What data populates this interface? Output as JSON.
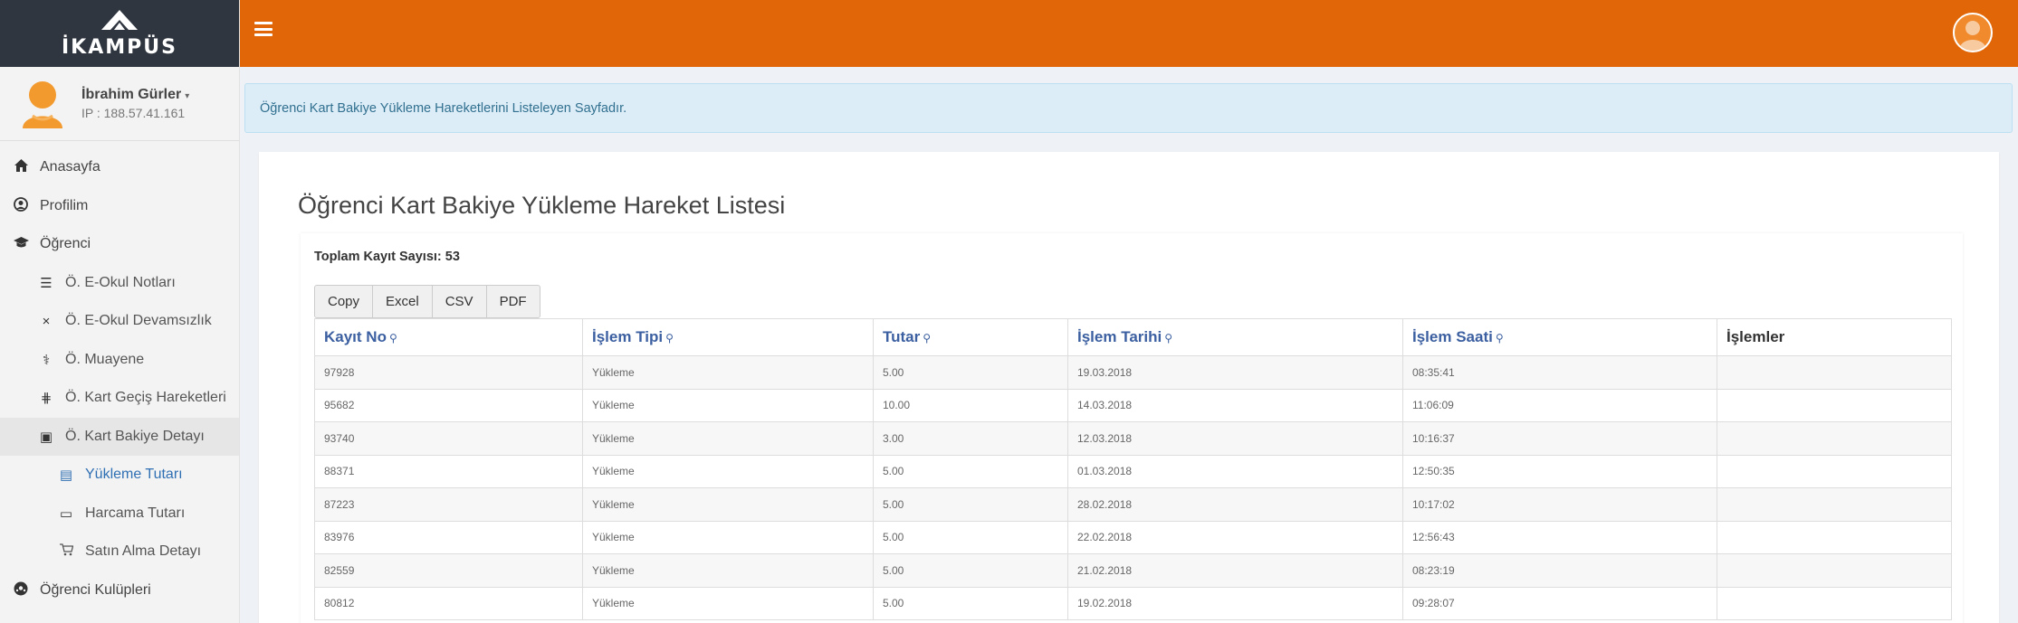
{
  "app": {
    "logo_text": "İKAMPÜS"
  },
  "user": {
    "name": "İbrahim Gürler",
    "caret": "▾",
    "ip": "IP : 188.57.41.161"
  },
  "sidebar": {
    "items": [
      {
        "label": "Anasayfa",
        "icon": "home-icon",
        "glyph": "⌂"
      },
      {
        "label": "Profilim",
        "icon": "profile-icon",
        "glyph": "☺"
      },
      {
        "label": "Öğrenci",
        "icon": "graduation-cap-icon",
        "glyph": "🎓"
      },
      {
        "label": "Ö. E-Okul Notları",
        "icon": "list-icon",
        "glyph": "☰"
      },
      {
        "label": "Ö. E-Okul Devamsızlık",
        "icon": "times-icon",
        "glyph": "×"
      },
      {
        "label": "Ö. Muayene",
        "icon": "stethoscope-icon",
        "glyph": "⚕"
      },
      {
        "label": "Ö. Kart Geçiş Hareketleri",
        "icon": "grid-icon",
        "glyph": "⋕"
      },
      {
        "label": "Ö. Kart Bakiye Detayı",
        "icon": "card-icon",
        "glyph": "▣"
      },
      {
        "label": "Yükleme Tutarı",
        "icon": "book-icon",
        "glyph": "▤"
      },
      {
        "label": "Harcama Tutarı",
        "icon": "credit-card-icon",
        "glyph": "▭"
      },
      {
        "label": "Satın Alma Detayı",
        "icon": "cart-icon",
        "glyph": "🛒"
      },
      {
        "label": "Öğrenci Kulüpleri",
        "icon": "club-icon",
        "glyph": "⚽"
      }
    ]
  },
  "alert": {
    "text": "Öğrenci Kart Bakiye Yükleme Hareketlerini Listeleyen Sayfadır."
  },
  "main": {
    "title": "Öğrenci Kart Bakiye Yükleme Hareket Listesi",
    "total_label": "Toplam Kayıt Sayısı: 53",
    "buttons": [
      "Copy",
      "Excel",
      "CSV",
      "PDF"
    ]
  },
  "table": {
    "columns": [
      "Kayıt No",
      "İşlem Tipi",
      "Tutar",
      "İşlem Tarihi",
      "İşlem Saati",
      "İşlemler"
    ],
    "sort_icon": "⚲",
    "rows": [
      [
        "97928",
        "Yükleme",
        "5.00",
        "19.03.2018",
        "08:35:41",
        ""
      ],
      [
        "95682",
        "Yükleme",
        "10.00",
        "14.03.2018",
        "11:06:09",
        ""
      ],
      [
        "93740",
        "Yükleme",
        "3.00",
        "12.03.2018",
        "10:16:37",
        ""
      ],
      [
        "88371",
        "Yükleme",
        "5.00",
        "01.03.2018",
        "12:50:35",
        ""
      ],
      [
        "87223",
        "Yükleme",
        "5.00",
        "28.02.2018",
        "10:17:02",
        ""
      ],
      [
        "83976",
        "Yükleme",
        "5.00",
        "22.02.2018",
        "12:56:43",
        ""
      ],
      [
        "82559",
        "Yükleme",
        "5.00",
        "21.02.2018",
        "08:23:19",
        ""
      ],
      [
        "80812",
        "Yükleme",
        "5.00",
        "19.02.2018",
        "09:28:07",
        ""
      ]
    ]
  },
  "colors": {
    "topbar": "#e06608",
    "sidebar_header": "#2f3640",
    "link": "#3b5fa0",
    "active": "#2f6fb3"
  }
}
